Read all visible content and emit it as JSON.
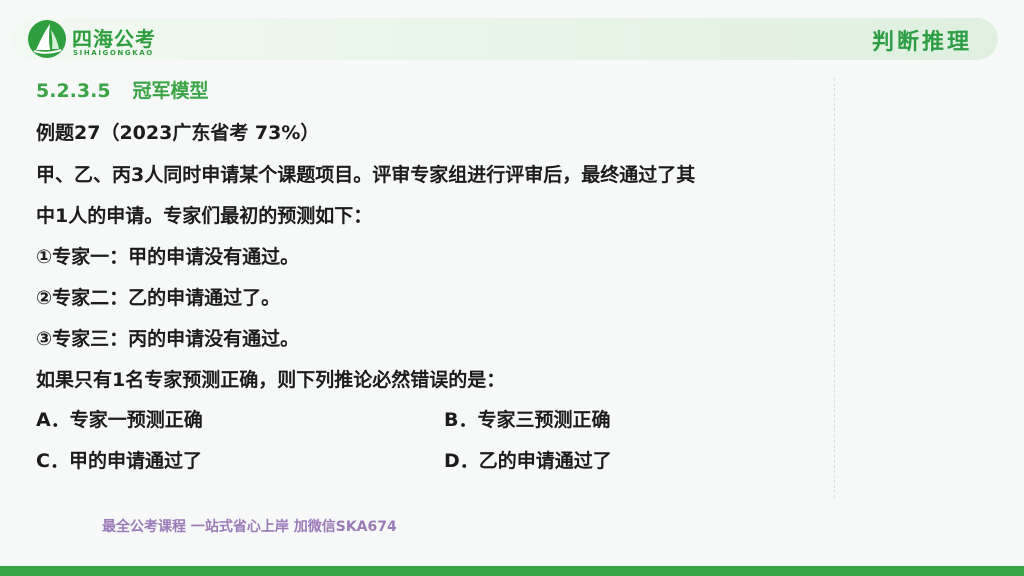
{
  "brand": {
    "name_cn": "四海公考",
    "name_en": "SIHAIGONGKAO"
  },
  "header": {
    "section": "判断推理"
  },
  "content": {
    "section_number": "5.2.3.5",
    "section_title": "冠军模型",
    "example_title": "例题27（2023广东省考 73%）",
    "question_lines": [
      "甲、乙、丙3人同时申请某个课题项目。评审专家组进行评审后，最终通过了其",
      "中1人的申请。专家们最初的预测如下：",
      "①专家一：甲的申请没有通过。",
      "②专家二：乙的申请通过了。",
      "③专家三：丙的申请没有通过。",
      "如果只有1名专家预测正确，则下列推论必然错误的是："
    ],
    "options": [
      "A．专家一预测正确",
      "B．专家三预测正确",
      "C．甲的申请通过了",
      "D．乙的申请通过了"
    ]
  },
  "footer": {
    "promo": "最全公考课程 一站式省心上岸 加微信SKA674"
  },
  "colors": {
    "brand_green": "#2f9e3f",
    "heading_green": "#3aa446",
    "promo_purple": "#9a7bb8"
  }
}
